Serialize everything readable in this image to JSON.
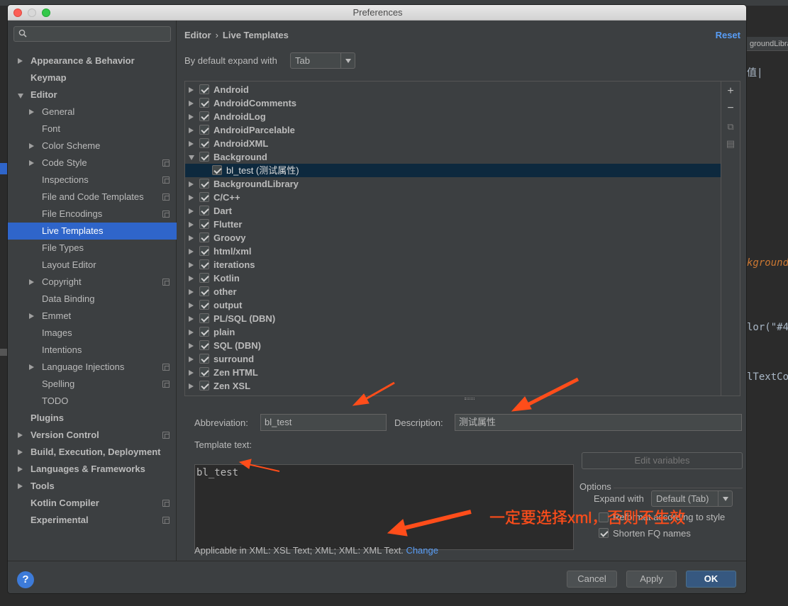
{
  "window": {
    "title": "Preferences"
  },
  "background": {
    "tab_label": "groundLibra",
    "code_lines": [
      "值|",
      "kground",
      "lor(\"#4",
      "lTextCo"
    ]
  },
  "sidebar": {
    "search_placeholder": "",
    "items": [
      {
        "label": "Appearance & Behavior",
        "level": 0,
        "bold": true,
        "arrow": "right"
      },
      {
        "label": "Keymap",
        "level": 0,
        "bold": true,
        "arrow": "none"
      },
      {
        "label": "Editor",
        "level": 0,
        "bold": true,
        "arrow": "down"
      },
      {
        "label": "General",
        "level": 1,
        "arrow": "right"
      },
      {
        "label": "Font",
        "level": 1,
        "arrow": "none"
      },
      {
        "label": "Color Scheme",
        "level": 1,
        "arrow": "right"
      },
      {
        "label": "Code Style",
        "level": 1,
        "arrow": "right",
        "copy": true
      },
      {
        "label": "Inspections",
        "level": 1,
        "arrow": "none",
        "copy": true
      },
      {
        "label": "File and Code Templates",
        "level": 1,
        "arrow": "none",
        "copy": true
      },
      {
        "label": "File Encodings",
        "level": 1,
        "arrow": "none",
        "copy": true
      },
      {
        "label": "Live Templates",
        "level": 1,
        "arrow": "none",
        "selected": true
      },
      {
        "label": "File Types",
        "level": 1,
        "arrow": "none"
      },
      {
        "label": "Layout Editor",
        "level": 1,
        "arrow": "none"
      },
      {
        "label": "Copyright",
        "level": 1,
        "arrow": "right",
        "copy": true
      },
      {
        "label": "Data Binding",
        "level": 1,
        "arrow": "none"
      },
      {
        "label": "Emmet",
        "level": 1,
        "arrow": "right"
      },
      {
        "label": "Images",
        "level": 1,
        "arrow": "none"
      },
      {
        "label": "Intentions",
        "level": 1,
        "arrow": "none"
      },
      {
        "label": "Language Injections",
        "level": 1,
        "arrow": "right",
        "copy": true
      },
      {
        "label": "Spelling",
        "level": 1,
        "arrow": "none",
        "copy": true
      },
      {
        "label": "TODO",
        "level": 1,
        "arrow": "none"
      },
      {
        "label": "Plugins",
        "level": 0,
        "bold": true,
        "arrow": "none"
      },
      {
        "label": "Version Control",
        "level": 0,
        "bold": true,
        "arrow": "right",
        "copy": true
      },
      {
        "label": "Build, Execution, Deployment",
        "level": 0,
        "bold": true,
        "arrow": "right"
      },
      {
        "label": "Languages & Frameworks",
        "level": 0,
        "bold": true,
        "arrow": "right"
      },
      {
        "label": "Tools",
        "level": 0,
        "bold": true,
        "arrow": "right"
      },
      {
        "label": "Kotlin Compiler",
        "level": 0,
        "bold": true,
        "arrow": "none",
        "copy": true
      },
      {
        "label": "Experimental",
        "level": 0,
        "bold": true,
        "arrow": "none",
        "copy": true
      }
    ]
  },
  "header": {
    "crumb_parent": "Editor",
    "crumb_sep": "›",
    "crumb_current": "Live Templates",
    "reset_label": "Reset"
  },
  "expand": {
    "label": "By default expand with",
    "value": "Tab"
  },
  "templates": [
    {
      "label": "Android",
      "expanded": false
    },
    {
      "label": "AndroidComments",
      "expanded": false
    },
    {
      "label": "AndroidLog",
      "expanded": false
    },
    {
      "label": "AndroidParcelable",
      "expanded": false
    },
    {
      "label": "AndroidXML",
      "expanded": false
    },
    {
      "label": "Background",
      "expanded": true
    },
    {
      "label": "bl_test (测试属性)",
      "child": true
    },
    {
      "label": "BackgroundLibrary",
      "expanded": false
    },
    {
      "label": "C/C++",
      "expanded": false
    },
    {
      "label": "Dart",
      "expanded": false
    },
    {
      "label": "Flutter",
      "expanded": false
    },
    {
      "label": "Groovy",
      "expanded": false
    },
    {
      "label": "html/xml",
      "expanded": false
    },
    {
      "label": "iterations",
      "expanded": false
    },
    {
      "label": "Kotlin",
      "expanded": false
    },
    {
      "label": "other",
      "expanded": false
    },
    {
      "label": "output",
      "expanded": false
    },
    {
      "label": "PL/SQL (DBN)",
      "expanded": false
    },
    {
      "label": "plain",
      "expanded": false
    },
    {
      "label": "SQL (DBN)",
      "expanded": false
    },
    {
      "label": "surround",
      "expanded": false
    },
    {
      "label": "Zen HTML",
      "expanded": false
    },
    {
      "label": "Zen XSL",
      "expanded": false
    }
  ],
  "tools": {
    "add": "+",
    "remove": "−",
    "copy": "⧉",
    "restore": "▤"
  },
  "form": {
    "abbreviation_label": "Abbreviation:",
    "abbreviation_value": "bl_test",
    "description_label": "Description:",
    "description_value": "测试属性",
    "template_text_label": "Template text:",
    "template_text_value": "bl_test",
    "edit_variables_label": "Edit variables",
    "options_title": "Options",
    "expand_with_label": "Expand with",
    "expand_with_value": "Default (Tab)",
    "reformat_label": "Reformat according to style",
    "shorten_label": "Shorten FQ names",
    "applicable_text": "Applicable in XML: XSL Text; XML; XML: XML Text.",
    "change_label": "Change"
  },
  "annotation": {
    "text": "一定要选择xml，否则不生效",
    "color": "#ff4d1a"
  },
  "footer": {
    "help_label": "?",
    "cancel_label": "Cancel",
    "apply_label": "Apply",
    "ok_label": "OK"
  },
  "colors": {
    "accent": "#2f65ca",
    "link": "#589df6",
    "panel": "#3c3f41",
    "editor": "#2b2b2b"
  }
}
